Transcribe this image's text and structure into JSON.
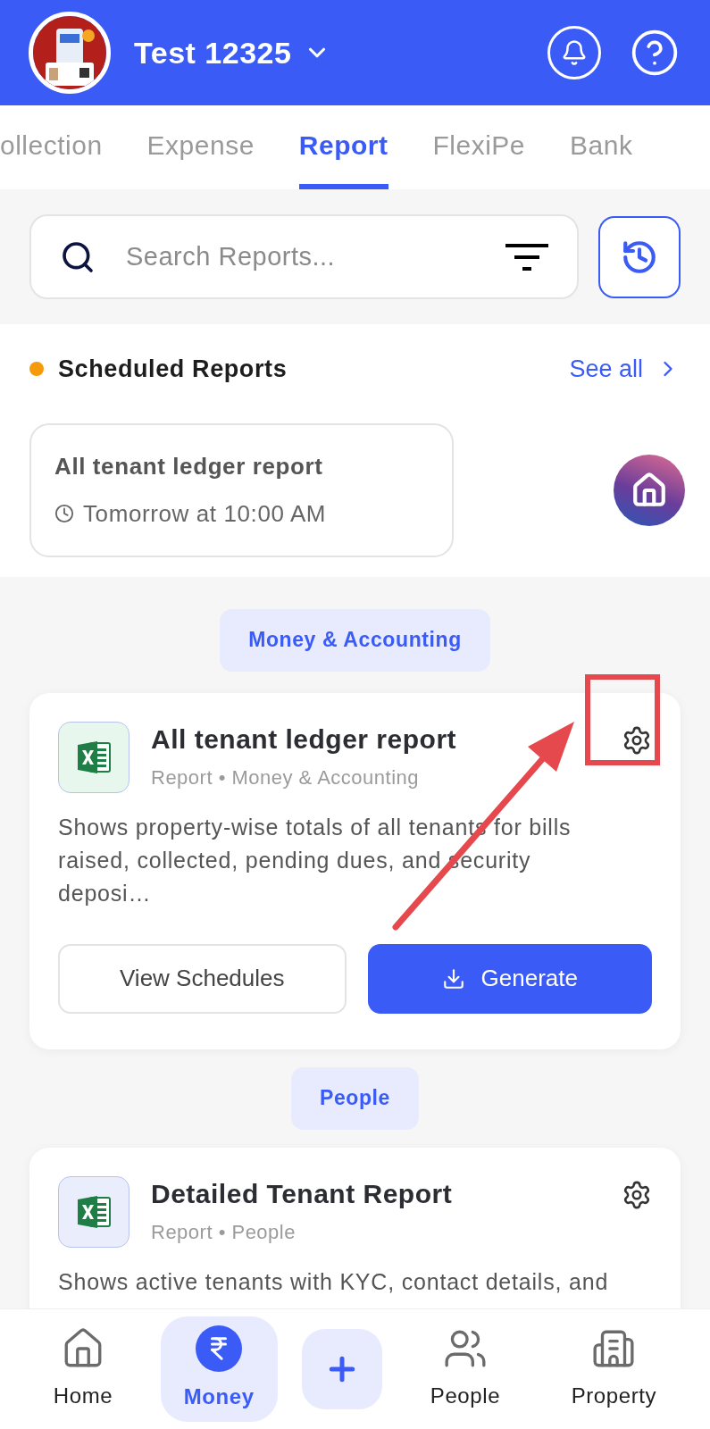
{
  "header": {
    "title": "Test 12325"
  },
  "tabs": [
    {
      "label": "ollection",
      "selected": false
    },
    {
      "label": "Expense",
      "selected": false
    },
    {
      "label": "Report",
      "selected": true
    },
    {
      "label": "FlexiPe",
      "selected": false
    },
    {
      "label": "Bank",
      "selected": false
    }
  ],
  "search": {
    "placeholder": "Search Reports..."
  },
  "scheduled": {
    "title": "Scheduled Reports",
    "see_all": "See all",
    "items": [
      {
        "title": "All tenant ledger report",
        "time": "Tomorrow at 10:00 AM"
      }
    ]
  },
  "groups": [
    {
      "label": "Money & Accounting",
      "reports": [
        {
          "title": "All tenant ledger report",
          "meta": "Report • Money & Accounting",
          "description": "Shows property-wise totals of all tenants for bills raised, collected, pending dues, and security deposi…",
          "secondary_button": "View Schedules",
          "primary_button": "Generate",
          "highlighted": true,
          "color": "#e8f7ee"
        }
      ]
    },
    {
      "label": "People",
      "reports": [
        {
          "title": "Detailed Tenant Report",
          "meta": "Report • People",
          "description": "Shows active tenants with KYC, contact details, and",
          "highlighted": false,
          "color": "#eaedfc"
        }
      ]
    }
  ],
  "nav": [
    {
      "kind": "home",
      "label": "Home",
      "selected": false
    },
    {
      "kind": "money",
      "label": "Money",
      "selected": true
    },
    {
      "kind": "add",
      "selected": false
    },
    {
      "kind": "people",
      "label": "People",
      "selected": false
    },
    {
      "kind": "property",
      "label": "Property",
      "selected": false
    }
  ]
}
